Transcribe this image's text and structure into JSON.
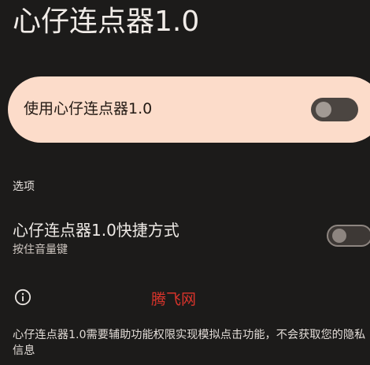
{
  "app": {
    "title": "心仔连点器1.0"
  },
  "main_toggle": {
    "label": "使用心仔连点器1.0",
    "checked": false
  },
  "options": {
    "section_title": "选项",
    "shortcut": {
      "title": "心仔连点器1.0快捷方式",
      "subtitle": "按住音量键",
      "checked": false
    }
  },
  "info": {
    "icon": "info-icon",
    "watermark": "腾飞网",
    "note": "心仔连点器1.0需要辅助功能权限实现模拟点击功能，不会获取您的隐私信息"
  },
  "colors": {
    "background": "#1c1b1a",
    "card": "#fcdcca",
    "watermark": "#d9342b"
  }
}
